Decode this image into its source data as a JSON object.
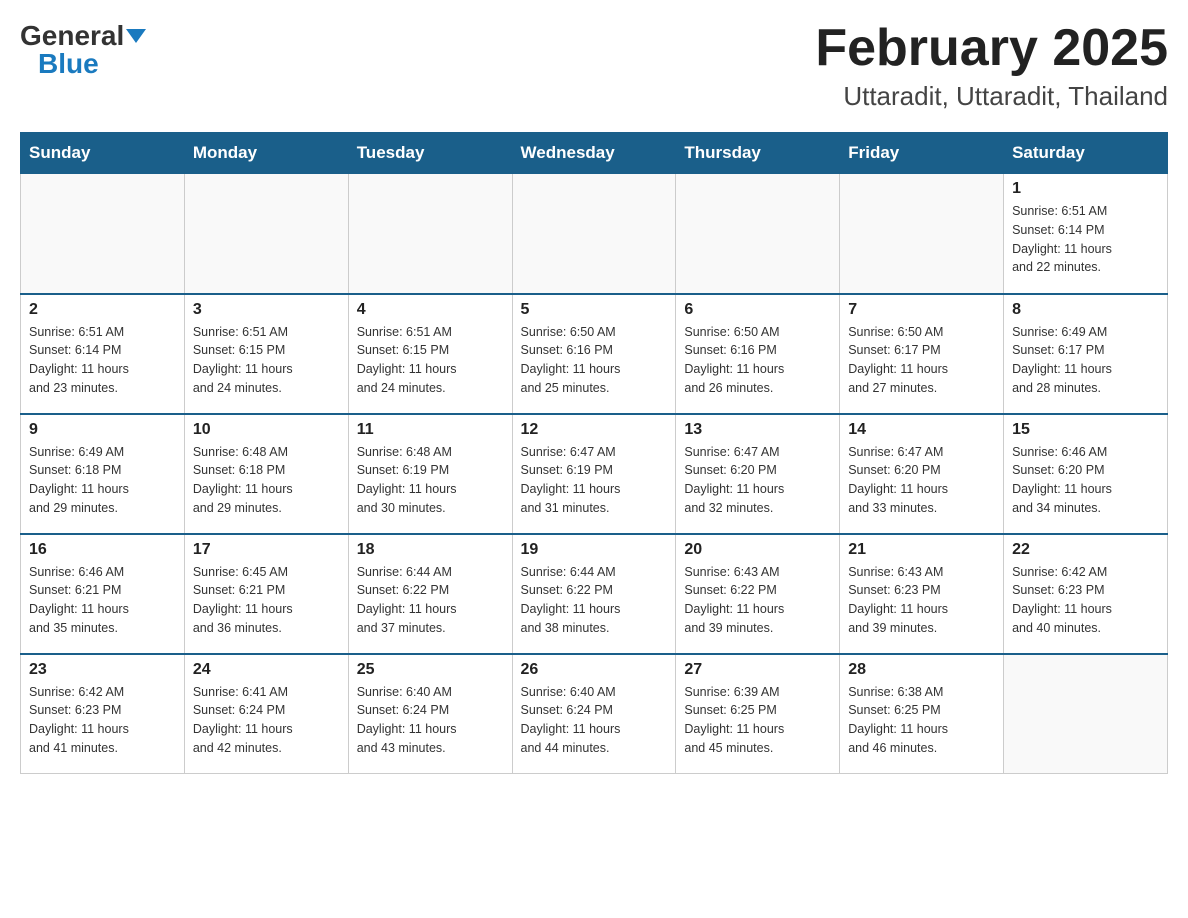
{
  "header": {
    "logo_general": "General",
    "logo_blue": "Blue",
    "month_title": "February 2025",
    "location": "Uttaradit, Uttaradit, Thailand"
  },
  "days_of_week": [
    "Sunday",
    "Monday",
    "Tuesday",
    "Wednesday",
    "Thursday",
    "Friday",
    "Saturday"
  ],
  "weeks": [
    [
      {
        "num": "",
        "info": ""
      },
      {
        "num": "",
        "info": ""
      },
      {
        "num": "",
        "info": ""
      },
      {
        "num": "",
        "info": ""
      },
      {
        "num": "",
        "info": ""
      },
      {
        "num": "",
        "info": ""
      },
      {
        "num": "1",
        "info": "Sunrise: 6:51 AM\nSunset: 6:14 PM\nDaylight: 11 hours\nand 22 minutes."
      }
    ],
    [
      {
        "num": "2",
        "info": "Sunrise: 6:51 AM\nSunset: 6:14 PM\nDaylight: 11 hours\nand 23 minutes."
      },
      {
        "num": "3",
        "info": "Sunrise: 6:51 AM\nSunset: 6:15 PM\nDaylight: 11 hours\nand 24 minutes."
      },
      {
        "num": "4",
        "info": "Sunrise: 6:51 AM\nSunset: 6:15 PM\nDaylight: 11 hours\nand 24 minutes."
      },
      {
        "num": "5",
        "info": "Sunrise: 6:50 AM\nSunset: 6:16 PM\nDaylight: 11 hours\nand 25 minutes."
      },
      {
        "num": "6",
        "info": "Sunrise: 6:50 AM\nSunset: 6:16 PM\nDaylight: 11 hours\nand 26 minutes."
      },
      {
        "num": "7",
        "info": "Sunrise: 6:50 AM\nSunset: 6:17 PM\nDaylight: 11 hours\nand 27 minutes."
      },
      {
        "num": "8",
        "info": "Sunrise: 6:49 AM\nSunset: 6:17 PM\nDaylight: 11 hours\nand 28 minutes."
      }
    ],
    [
      {
        "num": "9",
        "info": "Sunrise: 6:49 AM\nSunset: 6:18 PM\nDaylight: 11 hours\nand 29 minutes."
      },
      {
        "num": "10",
        "info": "Sunrise: 6:48 AM\nSunset: 6:18 PM\nDaylight: 11 hours\nand 29 minutes."
      },
      {
        "num": "11",
        "info": "Sunrise: 6:48 AM\nSunset: 6:19 PM\nDaylight: 11 hours\nand 30 minutes."
      },
      {
        "num": "12",
        "info": "Sunrise: 6:47 AM\nSunset: 6:19 PM\nDaylight: 11 hours\nand 31 minutes."
      },
      {
        "num": "13",
        "info": "Sunrise: 6:47 AM\nSunset: 6:20 PM\nDaylight: 11 hours\nand 32 minutes."
      },
      {
        "num": "14",
        "info": "Sunrise: 6:47 AM\nSunset: 6:20 PM\nDaylight: 11 hours\nand 33 minutes."
      },
      {
        "num": "15",
        "info": "Sunrise: 6:46 AM\nSunset: 6:20 PM\nDaylight: 11 hours\nand 34 minutes."
      }
    ],
    [
      {
        "num": "16",
        "info": "Sunrise: 6:46 AM\nSunset: 6:21 PM\nDaylight: 11 hours\nand 35 minutes."
      },
      {
        "num": "17",
        "info": "Sunrise: 6:45 AM\nSunset: 6:21 PM\nDaylight: 11 hours\nand 36 minutes."
      },
      {
        "num": "18",
        "info": "Sunrise: 6:44 AM\nSunset: 6:22 PM\nDaylight: 11 hours\nand 37 minutes."
      },
      {
        "num": "19",
        "info": "Sunrise: 6:44 AM\nSunset: 6:22 PM\nDaylight: 11 hours\nand 38 minutes."
      },
      {
        "num": "20",
        "info": "Sunrise: 6:43 AM\nSunset: 6:22 PM\nDaylight: 11 hours\nand 39 minutes."
      },
      {
        "num": "21",
        "info": "Sunrise: 6:43 AM\nSunset: 6:23 PM\nDaylight: 11 hours\nand 39 minutes."
      },
      {
        "num": "22",
        "info": "Sunrise: 6:42 AM\nSunset: 6:23 PM\nDaylight: 11 hours\nand 40 minutes."
      }
    ],
    [
      {
        "num": "23",
        "info": "Sunrise: 6:42 AM\nSunset: 6:23 PM\nDaylight: 11 hours\nand 41 minutes."
      },
      {
        "num": "24",
        "info": "Sunrise: 6:41 AM\nSunset: 6:24 PM\nDaylight: 11 hours\nand 42 minutes."
      },
      {
        "num": "25",
        "info": "Sunrise: 6:40 AM\nSunset: 6:24 PM\nDaylight: 11 hours\nand 43 minutes."
      },
      {
        "num": "26",
        "info": "Sunrise: 6:40 AM\nSunset: 6:24 PM\nDaylight: 11 hours\nand 44 minutes."
      },
      {
        "num": "27",
        "info": "Sunrise: 6:39 AM\nSunset: 6:25 PM\nDaylight: 11 hours\nand 45 minutes."
      },
      {
        "num": "28",
        "info": "Sunrise: 6:38 AM\nSunset: 6:25 PM\nDaylight: 11 hours\nand 46 minutes."
      },
      {
        "num": "",
        "info": ""
      }
    ]
  ]
}
